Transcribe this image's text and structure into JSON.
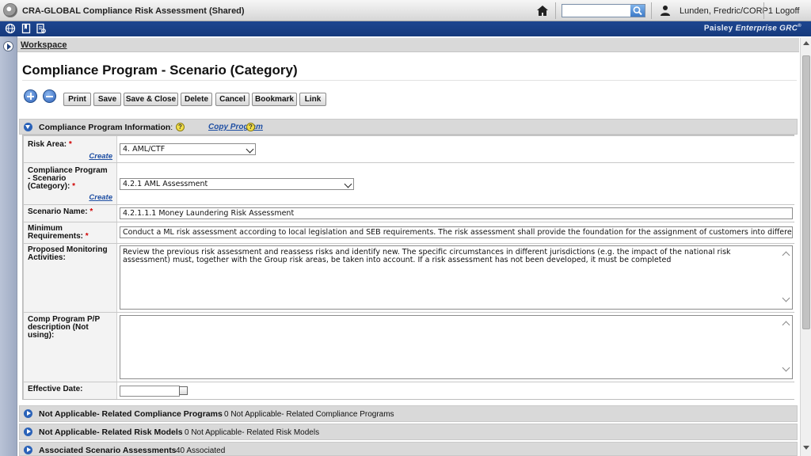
{
  "window": {
    "title": "CRA-GLOBAL Compliance Risk Assessment (Shared)",
    "search_placeholder": "",
    "user": "Lunden, Fredric/CORP1",
    "logoff": "Logoff"
  },
  "brand": {
    "name": "Paisley",
    "product": "Enterprise GRC",
    "mark": "®"
  },
  "breadcrumb": "Workspace",
  "page": {
    "title": "Compliance Program - Scenario (Category)"
  },
  "actions": {
    "print": "Print",
    "save": "Save",
    "save_close": "Save & Close",
    "delete": "Delete",
    "cancel": "Cancel",
    "bookmark": "Bookmark",
    "link": "Link"
  },
  "section_main": {
    "title": "Compliance Program Information",
    "colon": ":",
    "copy_program": "Copy Program",
    "help": "?"
  },
  "form": {
    "required_mark": "*",
    "create": "Create",
    "risk_area": {
      "label": "Risk Area:",
      "value": "4. AML/CTF"
    },
    "scenario_category": {
      "label_lines": [
        "Compliance Program",
        "- Scenario",
        "(Category):"
      ],
      "value": "4.2.1 AML Assessment"
    },
    "scenario_name": {
      "label": "Scenario Name:",
      "value": "4.2.1.1.1 Money Laundering Risk Assessment"
    },
    "minimum_requirements": {
      "label_lines": [
        "Minimum",
        "Requirements:"
      ],
      "value": "Conduct a ML risk assessment according to local legislation and SEB requirements. The risk assessment shall provide the foundation for the assignment of customers into different due diligence leve"
    },
    "proposed_monitoring": {
      "label_lines": [
        "Proposed Monitoring",
        "Activities:"
      ],
      "value": "Review the previous risk assessment and reassess risks and identify new. The specific circumstances in different jurisdictions (e.g. the impact of the national risk assessment) must, together with the Group risk areas, be taken into account. If a risk assessment has not been developed, it must be completed"
    },
    "comp_program_pp": {
      "label_lines": [
        "Comp Program P/P",
        "description (Not",
        "using):"
      ],
      "value": ""
    },
    "effective_date": {
      "label": "Effective Date:",
      "value": ""
    }
  },
  "collapsed_sections": [
    {
      "title": "Not Applicable- Related Compliance Programs",
      "summary": "0 Not Applicable- Related Compliance Programs"
    },
    {
      "title": "Not Applicable- Related Risk Models",
      "summary": "0  Not Applicable- Related Risk Models"
    },
    {
      "title": "Associated Scenario Assessments",
      "summary": "40 Associated"
    }
  ],
  "colors": {
    "toolbar_blue": "#1d4590",
    "link_blue": "#1f4fa3",
    "required_red": "#d00000",
    "section_gray": "#d9d9d9"
  }
}
